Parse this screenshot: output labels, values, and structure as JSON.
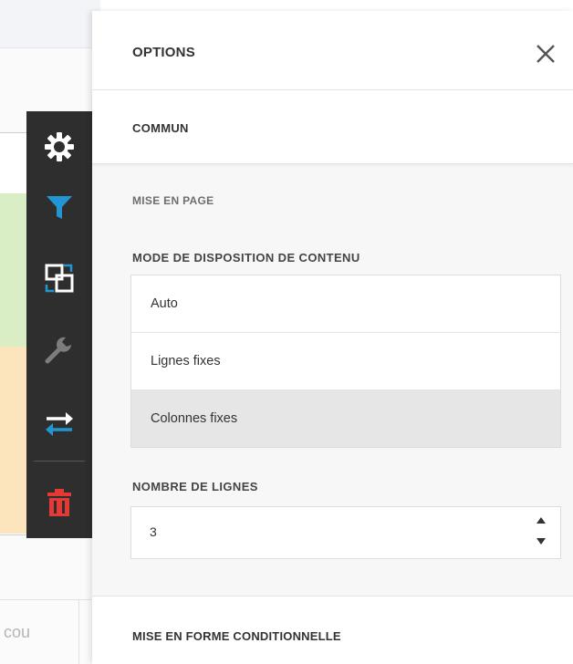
{
  "background": {
    "partial_text": "cou"
  },
  "toolbar": {
    "items": [
      {
        "icon": "gear-icon",
        "color": "#ffffff"
      },
      {
        "icon": "filter-icon",
        "color": "#2196d3"
      },
      {
        "icon": "layout-icon",
        "color": "#ffffff"
      },
      {
        "icon": "wrench-icon",
        "color": "#7d7d7d"
      },
      {
        "icon": "swap-icon",
        "color": "#ffffff"
      },
      {
        "icon": "trash-icon",
        "color": "#e53935"
      }
    ]
  },
  "panel": {
    "title": "OPTIONS",
    "section": "COMMUN",
    "subsection": "MISE EN PAGE",
    "layout_mode": {
      "label": "MODE DE DISPOSITION DE CONTENU",
      "options": [
        "Auto",
        "Lignes fixes",
        "Colonnes fixes"
      ],
      "selected": "Colonnes fixes"
    },
    "rows": {
      "label": "NOMBRE DE LIGNES",
      "value": "3"
    },
    "next_section": "MISE EN FORME CONDITIONNELLE"
  }
}
